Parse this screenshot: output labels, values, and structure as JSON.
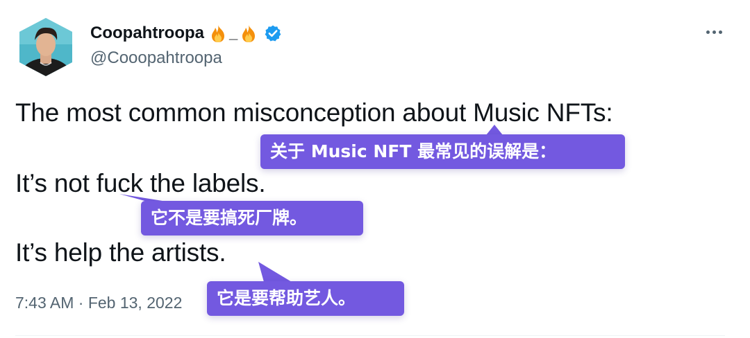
{
  "tweet": {
    "display_name": "Coopahtroopa",
    "name_separator": "_",
    "handle": "@Cooopahtroopa",
    "lines": [
      "The most common misconception about Music NFTs:",
      "It’s not fuck the labels.",
      "It’s help the artists."
    ],
    "timestamp": "7:43 AM · Feb 13, 2022"
  },
  "callouts": [
    "关于 Music NFT 最常见的误解是：",
    "它不是要搞死厂牌。",
    "它是要帮助艺人。"
  ],
  "icons": {
    "flame_left": "fire-emoji-icon",
    "flame_right": "fire-emoji-icon",
    "verified": "verified-badge-icon",
    "more": "more-options-icon"
  },
  "colors": {
    "callout_bg": "#7359e0",
    "verified_blue": "#1d9bf0",
    "secondary_text": "#536471"
  }
}
